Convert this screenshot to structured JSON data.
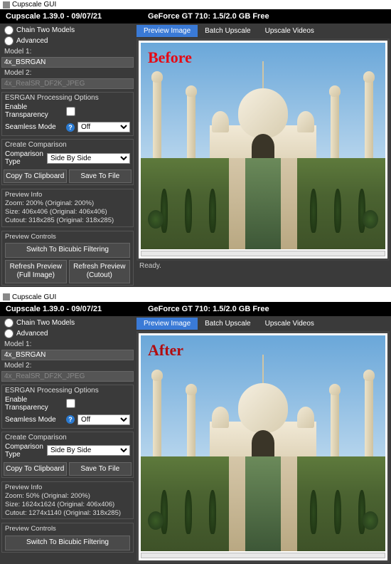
{
  "before": {
    "titlebar": "Cupscale GUI",
    "banner_left": "Cupscale 1.39.0 - 09/07/21",
    "banner_right": "GeForce GT 710: 1.5/2.0 GB Free",
    "radio_chain": "Chain Two Models",
    "radio_advanced": "Advanced",
    "model1_label": "Model 1:",
    "model1_value": "4x_BSRGAN",
    "model2_label": "Model 2:",
    "model2_value": "4x_RealSR_DF2K_JPEG",
    "esrgan_title": "ESRGAN Processing Options",
    "enable_transparency": "Enable Transparency",
    "seamless_label": "Seamless Mode",
    "seamless_value": "Off",
    "compare_title": "Create Comparison",
    "comparison_type_label": "Comparison Type",
    "comparison_type_value": "Side By Side",
    "copy_btn": "Copy To Clipboard",
    "save_btn": "Save To File",
    "preview_info_title": "Preview Info",
    "pi_zoom": "Zoom: 200% (Original: 200%)",
    "pi_size": "Size: 406x406 (Original: 406x406)",
    "pi_cutout": "Cutout: 318x285 (Original: 318x285)",
    "preview_controls_title": "Preview Controls",
    "switch_btn": "Switch To Bicubic Filtering",
    "refresh_full": "Refresh Preview (Full Image)",
    "refresh_cutout": "Refresh Preview (Cutout)",
    "tab_preview": "Preview Image",
    "tab_batch": "Batch Upscale",
    "tab_videos": "Upscale Videos",
    "overlay": "Before",
    "status": "Ready."
  },
  "after": {
    "titlebar": "Cupscale GUI",
    "banner_left": "Cupscale 1.39.0 - 09/07/21",
    "banner_right": "GeForce GT 710: 1.5/2.0 GB Free",
    "radio_chain": "Chain Two Models",
    "radio_advanced": "Advanced",
    "model1_label": "Model 1:",
    "model1_value": "4x_BSRGAN",
    "model2_label": "Model 2:",
    "model2_value": "4x_RealSR_DF2K_JPEG",
    "esrgan_title": "ESRGAN Processing Options",
    "enable_transparency": "Enable Transparency",
    "seamless_label": "Seamless Mode",
    "seamless_value": "Off",
    "compare_title": "Create Comparison",
    "comparison_type_label": "Comparison Type",
    "comparison_type_value": "Side By Side",
    "copy_btn": "Copy To Clipboard",
    "save_btn": "Save To File",
    "preview_info_title": "Preview Info",
    "pi_zoom": "Zoom: 50% (Original: 200%)",
    "pi_size": "Size: 1624x1624 (Original: 406x406)",
    "pi_cutout": "Cutout: 1274x1140 (Original: 318x285)",
    "preview_controls_title": "Preview Controls",
    "switch_btn": "Switch To Bicubic Filtering",
    "tab_preview": "Preview Image",
    "tab_batch": "Batch Upscale",
    "tab_videos": "Upscale Videos",
    "overlay": "After"
  }
}
